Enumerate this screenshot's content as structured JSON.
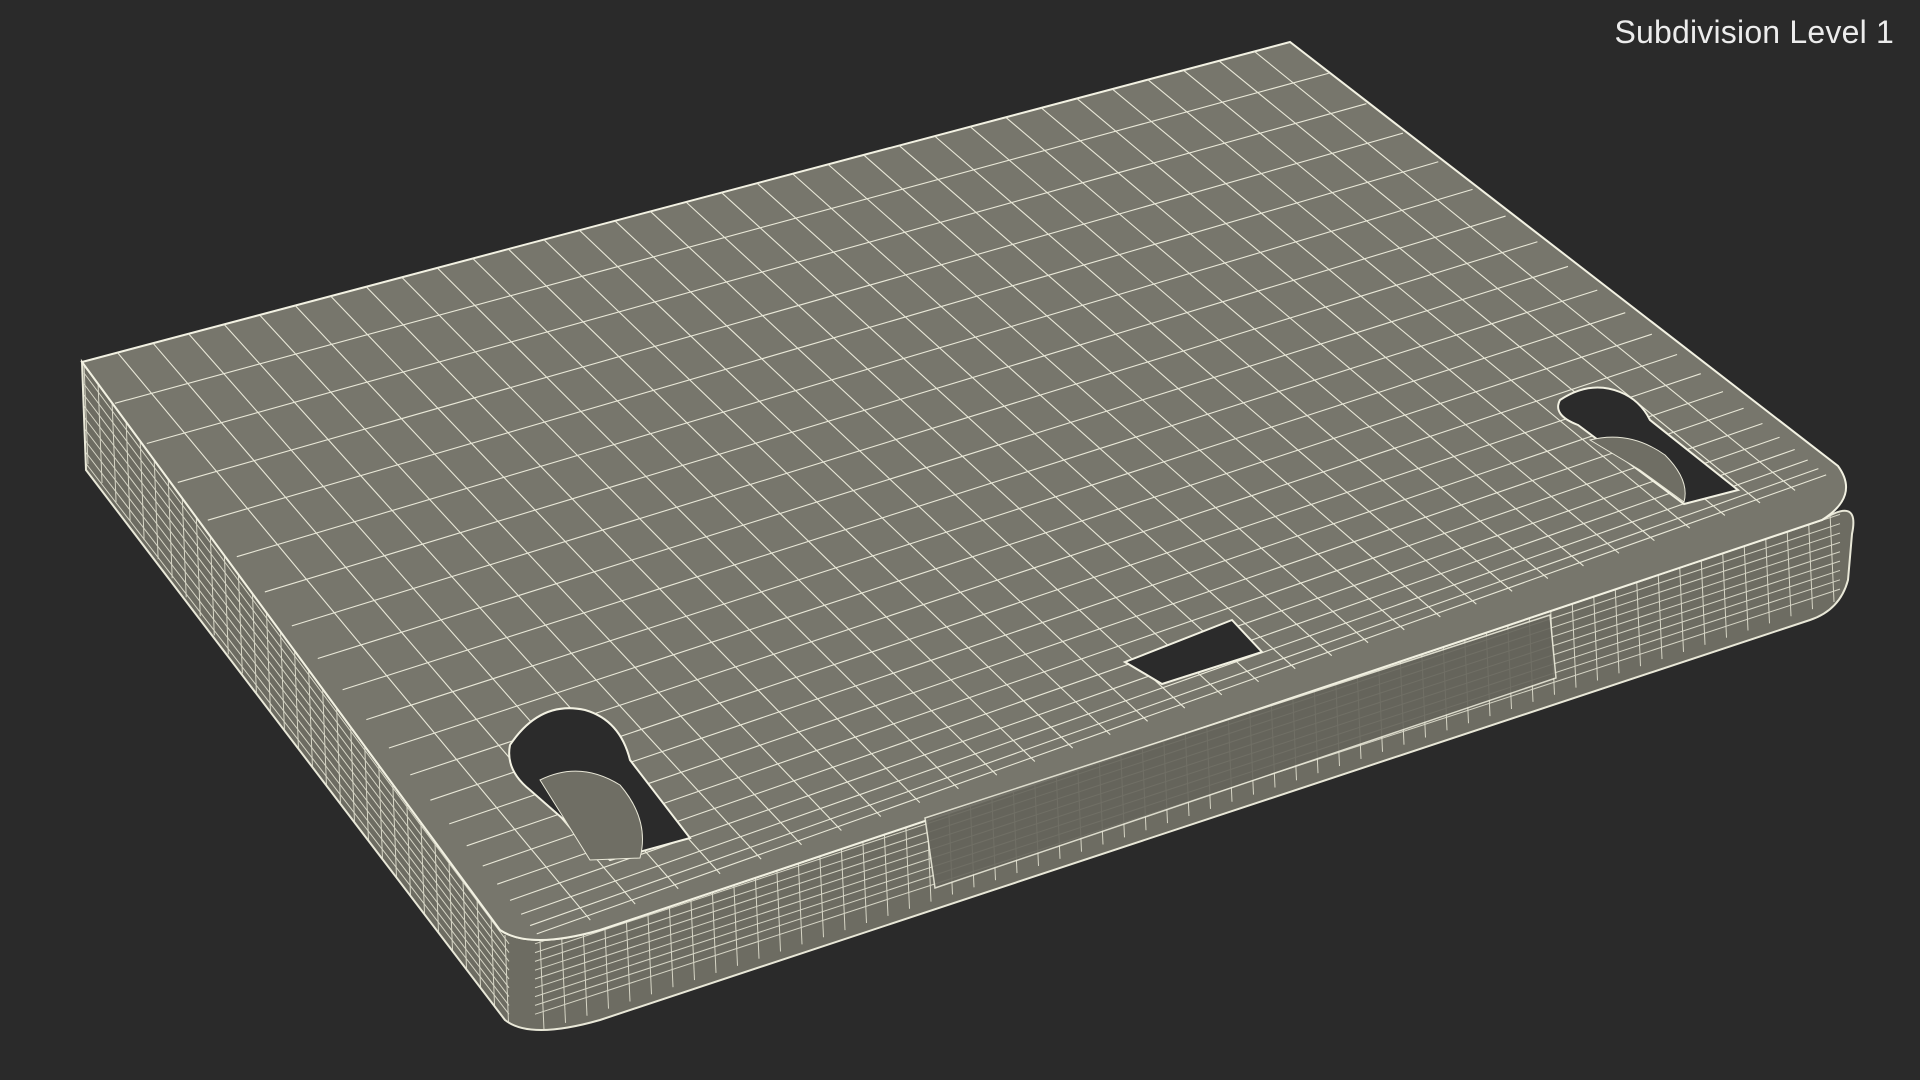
{
  "viewport": {
    "overlay_label": "Subdivision Level 1"
  },
  "model": {
    "description_icon": "wireframe-mesh",
    "colors": {
      "background": "#2a2a2a",
      "surface": "#77766c",
      "side": "#6f6e64",
      "wire": "#e9e8d8",
      "hole": "#2a2a2a"
    }
  }
}
